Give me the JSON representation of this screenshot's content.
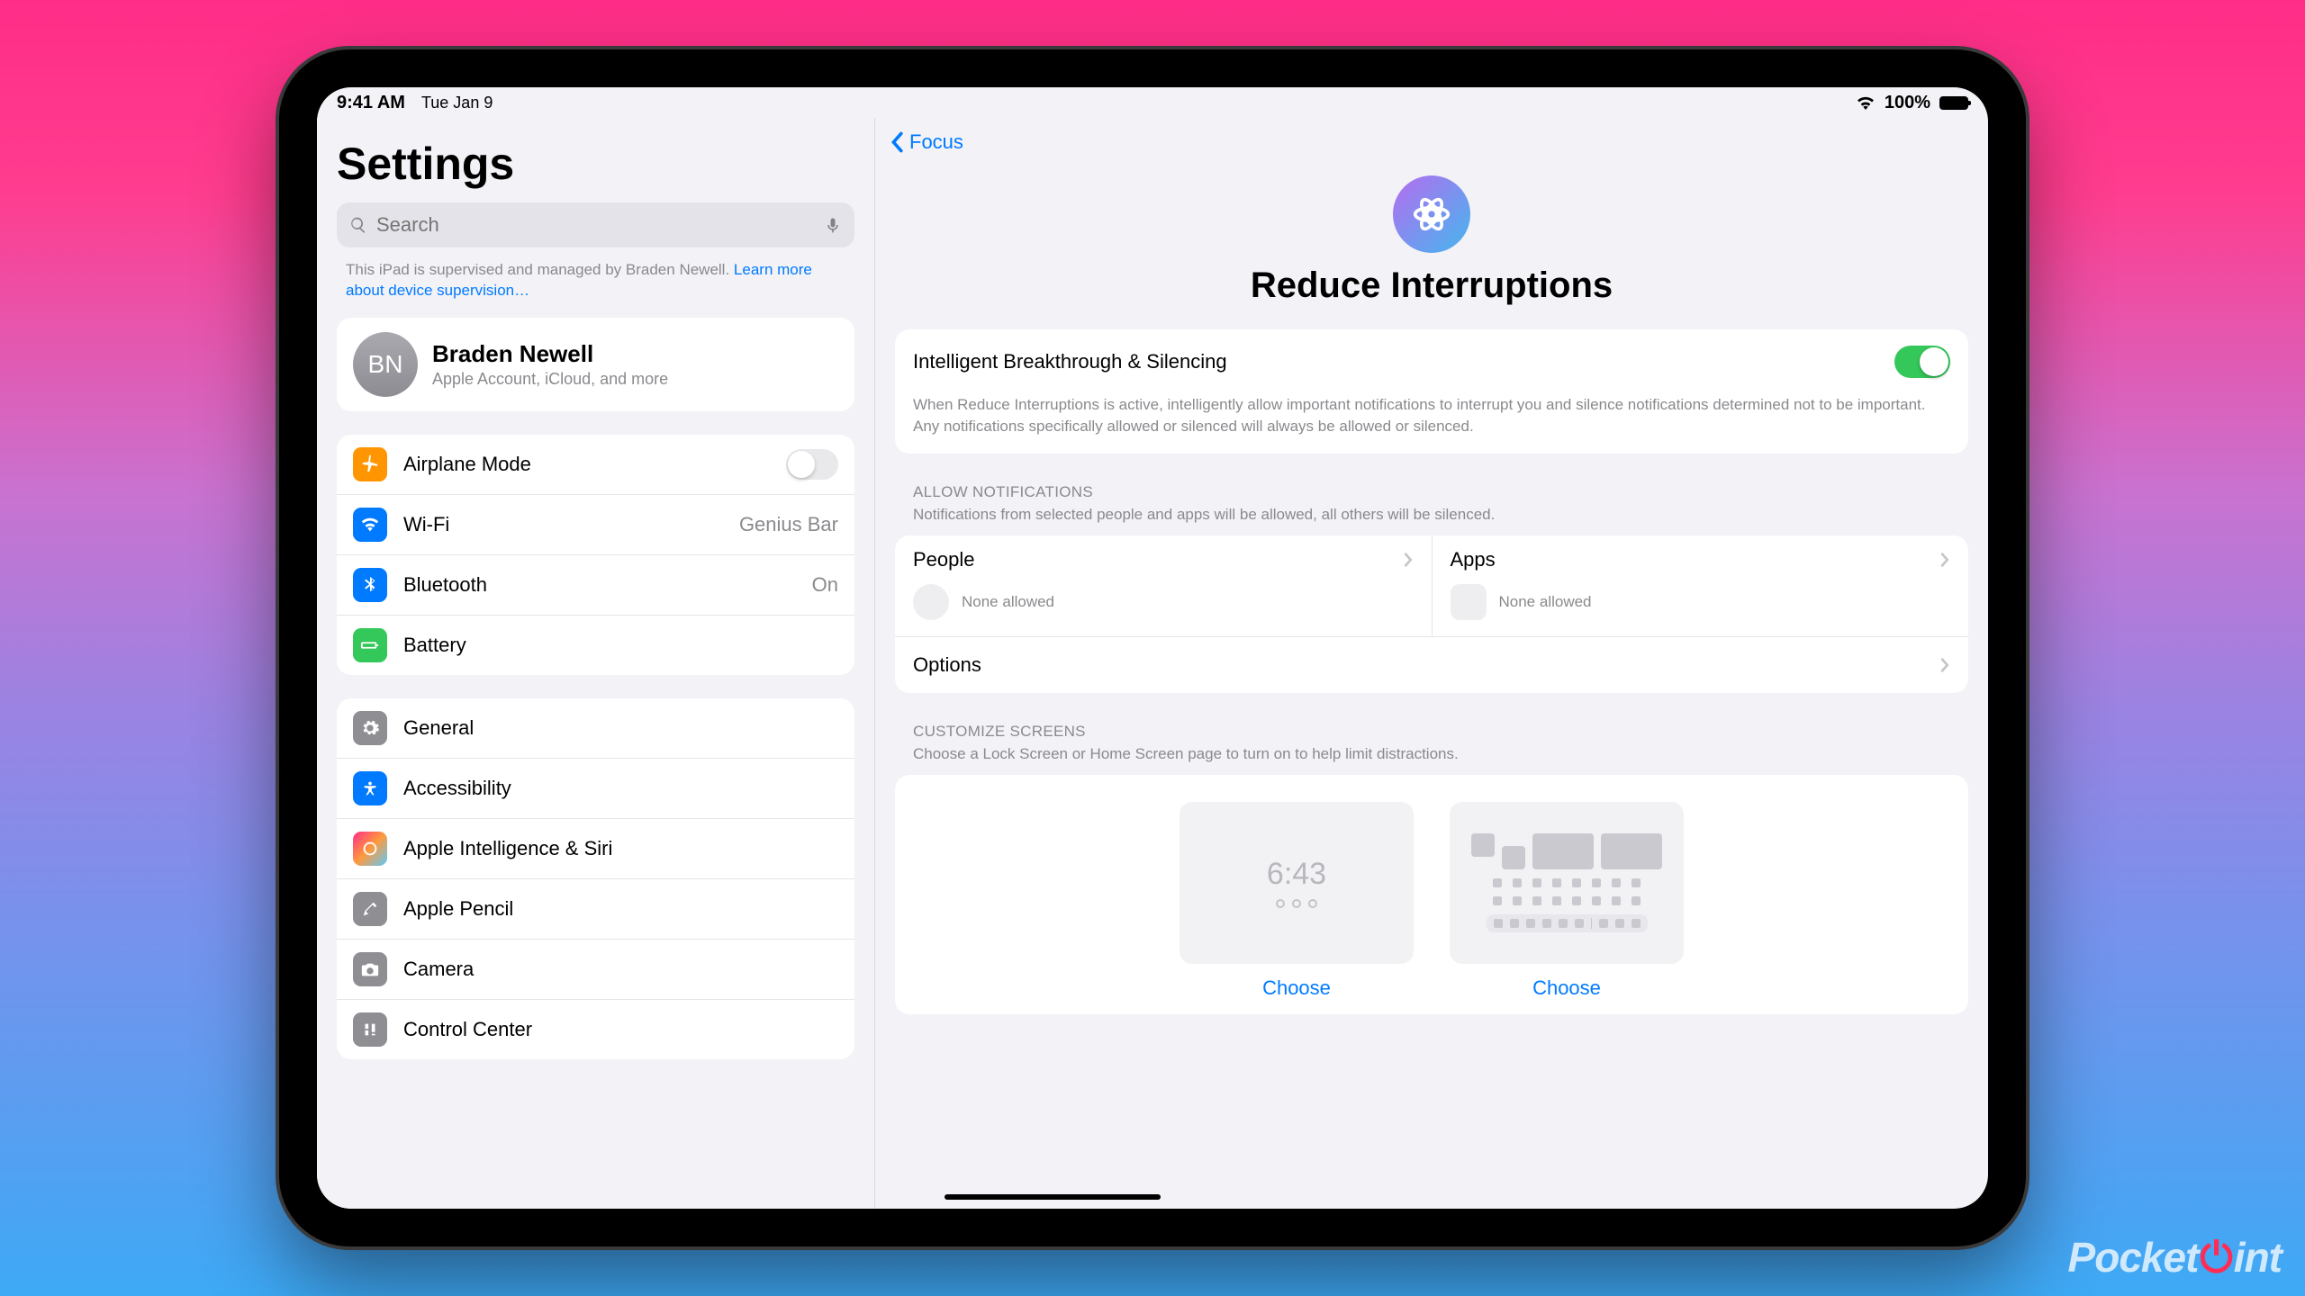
{
  "statusbar": {
    "time": "9:41 AM",
    "date": "Tue Jan 9",
    "battery": "100%"
  },
  "sidebar": {
    "title": "Settings",
    "search_placeholder": "Search",
    "supervised_text": "This iPad is supervised and managed by Braden Newell.",
    "supervised_link": "Learn more about device supervision…",
    "profile": {
      "initials": "BN",
      "name": "Braden Newell",
      "sub": "Apple Account, iCloud, and more"
    },
    "g1": {
      "airplane": "Airplane Mode",
      "wifi": "Wi-Fi",
      "wifi_val": "Genius Bar",
      "bt": "Bluetooth",
      "bt_val": "On",
      "battery": "Battery"
    },
    "g2": {
      "general": "General",
      "accessibility": "Accessibility",
      "ai": "Apple Intelligence & Siri",
      "pencil": "Apple Pencil",
      "camera": "Camera",
      "control": "Control Center"
    }
  },
  "main": {
    "back": "Focus",
    "title": "Reduce Interruptions",
    "toggle_label": "Intelligent Breakthrough & Silencing",
    "toggle_desc": "When Reduce Interruptions is active, intelligently allow important notifications to interrupt you and silence notifications determined not to be important. Any notifications specifically allowed or silenced will always be allowed or silenced.",
    "allow_header": "ALLOW NOTIFICATIONS",
    "allow_sub": "Notifications from selected people and apps will be allowed, all others will be silenced.",
    "people": "People",
    "apps": "Apps",
    "none": "None allowed",
    "options": "Options",
    "cust_header": "CUSTOMIZE SCREENS",
    "cust_sub": "Choose a Lock Screen or Home Screen page to turn on to help limit distractions.",
    "lock_time": "6:43",
    "choose": "Choose"
  },
  "watermark": {
    "pre": "Pocket",
    "mid": "l",
    "post": "int"
  },
  "colors": {
    "airplane": "#ff9500",
    "wifi": "#007aff",
    "bt": "#007aff",
    "battery": "#34c759",
    "general": "#8e8e93",
    "accessibility": "#007aff",
    "ai_grad": "linear-gradient(135deg,#ff2d87,#5ac8fa)",
    "pencil": "#8e8e93",
    "camera": "#8e8e93",
    "control": "#8e8e93"
  }
}
